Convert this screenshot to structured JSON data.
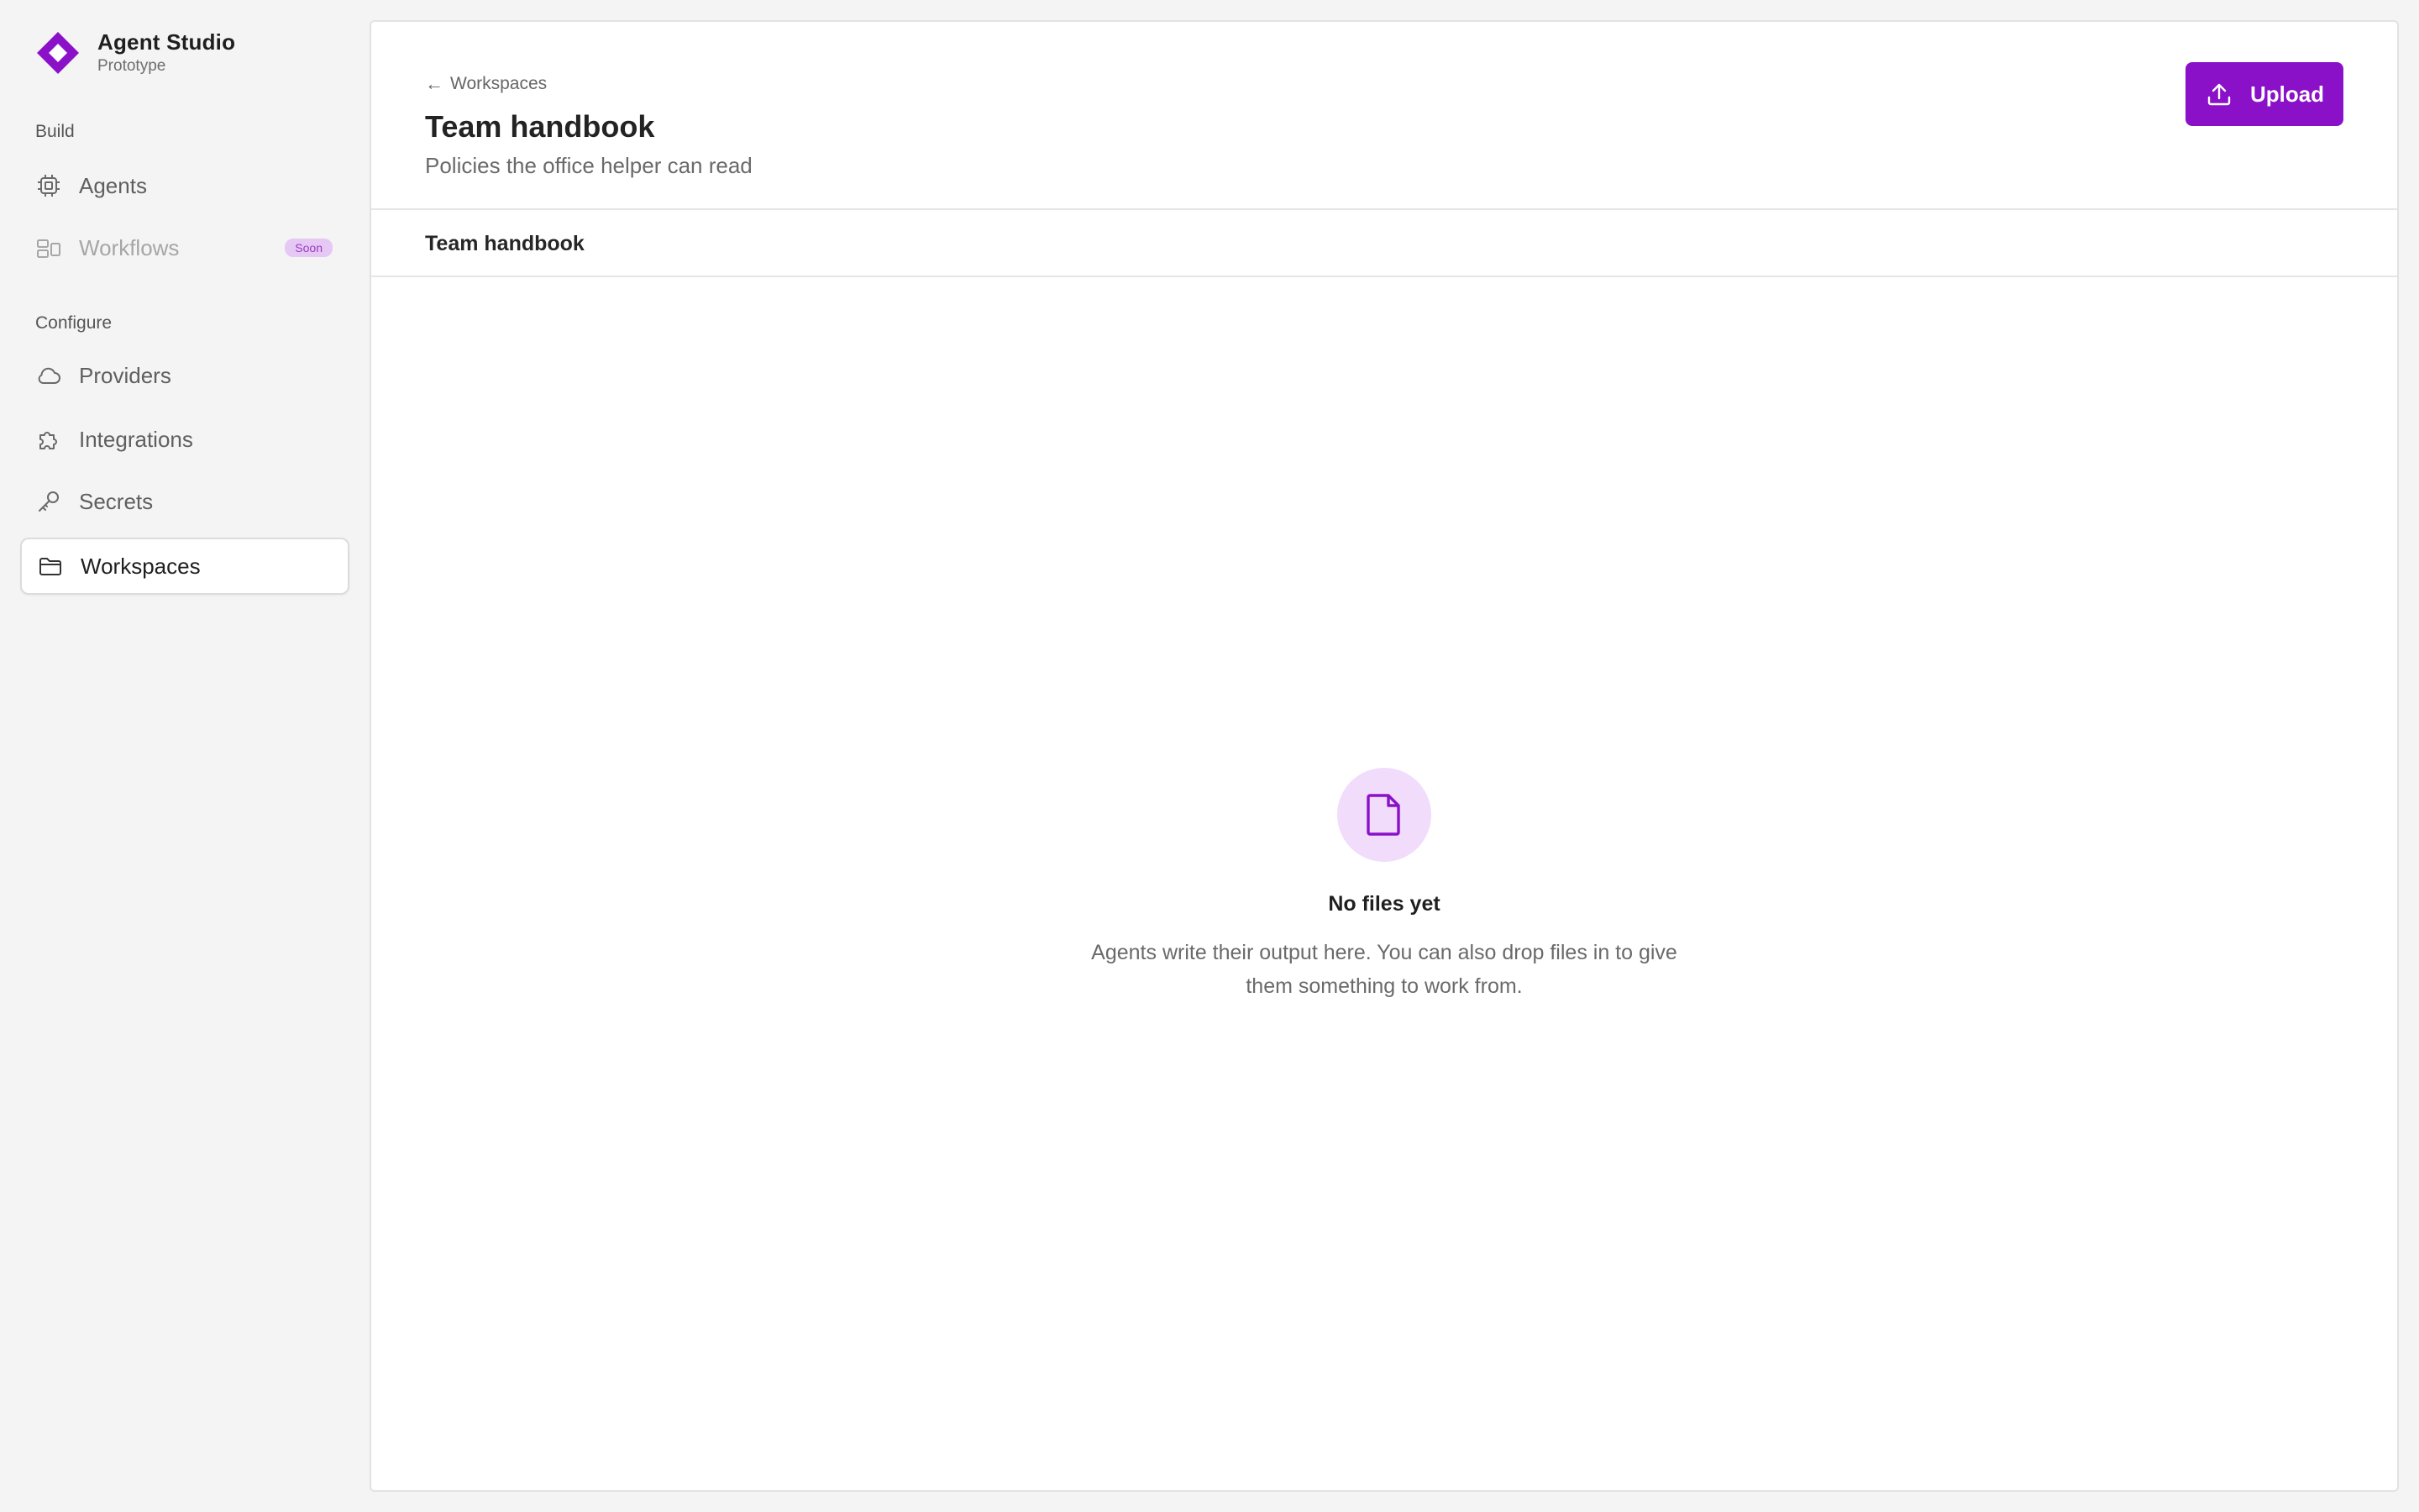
{
  "brand": {
    "name": "Agent Studio",
    "subtitle": "Prototype",
    "logo_icon": "diamond-logo",
    "accent_color": "#8b11c9"
  },
  "sidebar": {
    "sections": [
      {
        "label": "Build",
        "items": [
          {
            "label": "Agents",
            "icon": "chip-icon",
            "state": "normal"
          },
          {
            "label": "Workflows",
            "icon": "workflow-icon",
            "state": "disabled",
            "badge": "Soon"
          }
        ]
      },
      {
        "label": "Configure",
        "items": [
          {
            "label": "Providers",
            "icon": "cloud-icon",
            "state": "normal"
          },
          {
            "label": "Integrations",
            "icon": "puzzle-icon",
            "state": "normal"
          },
          {
            "label": "Secrets",
            "icon": "key-icon",
            "state": "normal"
          },
          {
            "label": "Workspaces",
            "icon": "folder-icon",
            "state": "active"
          }
        ]
      }
    ]
  },
  "header": {
    "back_label": "Workspaces",
    "title": "Team handbook",
    "subtitle": "Policies the office helper can read",
    "upload_label": "Upload"
  },
  "tabs": [
    {
      "label": "Team handbook",
      "active": true
    }
  ],
  "empty_state": {
    "icon": "file-icon",
    "title": "No files yet",
    "description": "Agents write their output here. You can also drop files in to give them something to work from."
  }
}
